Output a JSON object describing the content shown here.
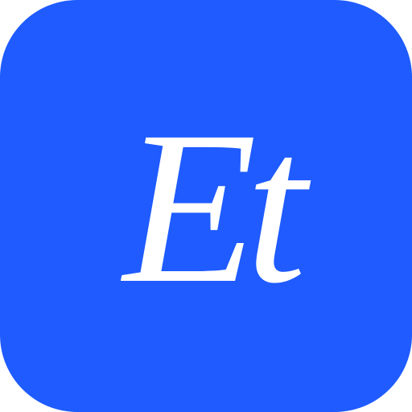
{
  "icon": {
    "glyph": "Et",
    "background_color": "#1F5BFF",
    "glyph_color": "#FFFFFF"
  }
}
